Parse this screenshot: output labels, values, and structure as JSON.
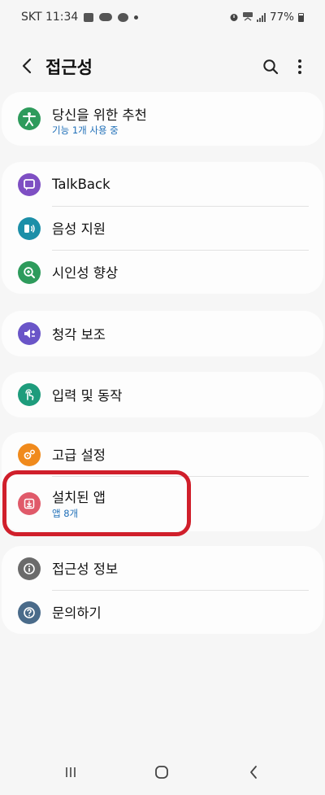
{
  "status_bar": {
    "carrier_time": "SKT 11:34",
    "battery": "77%"
  },
  "header": {
    "title": "접근성"
  },
  "items": {
    "recommend": {
      "label": "당신을 위한 추천",
      "sub": "기능 1개 사용 중",
      "color": "#2e9b5c",
      "icon": "accessibility-person-icon"
    },
    "talkback": {
      "label": "TalkBack",
      "color": "#7e4fc3",
      "icon": "speech-bubble-icon"
    },
    "voice_assist": {
      "label": "음성 지원",
      "color": "#1c8fa8",
      "icon": "voice-assist-icon"
    },
    "visibility": {
      "label": "시인성 향상",
      "color": "#2e9b5c",
      "icon": "magnifier-plus-icon"
    },
    "hearing": {
      "label": "청각 보조",
      "color": "#6a55c8",
      "icon": "speaker-volume-icon"
    },
    "interaction": {
      "label": "입력 및 동작",
      "color": "#1e9c7c",
      "icon": "touch-hand-icon"
    },
    "advanced": {
      "label": "고급 설정",
      "color": "#f08a1c",
      "icon": "gears-icon"
    },
    "installed_apps": {
      "label": "설치된 앱",
      "sub": "앱 8개",
      "color": "#e05a6a",
      "icon": "download-box-icon"
    },
    "about": {
      "label": "접근성 정보",
      "color": "#6b6b6b",
      "icon": "info-icon"
    },
    "contact": {
      "label": "문의하기",
      "color": "#4a6b8a",
      "icon": "question-icon"
    }
  }
}
